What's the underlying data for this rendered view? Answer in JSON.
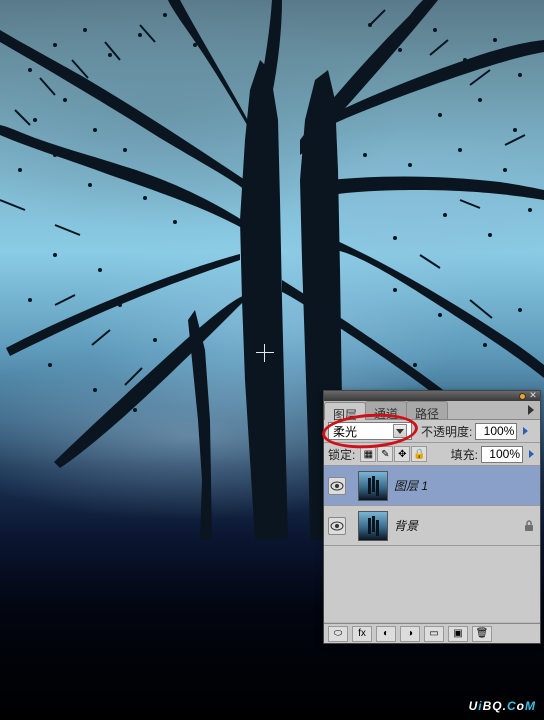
{
  "watermark": {
    "text_prefix": "U",
    "text_mid": "i",
    "text_mid2": "BQ.",
    "text_suffix": "C",
    "text_mid3": "o",
    "text_end": "M"
  },
  "panel": {
    "tabs": {
      "layers": "图层",
      "channels": "通道",
      "paths": "路径"
    },
    "blend_mode": "柔光",
    "opacity_label": "不透明度:",
    "opacity_value": "100%",
    "lock_label": "锁定:",
    "fill_label": "填充:",
    "fill_value": "100%",
    "layers": [
      {
        "name": "图层 1",
        "locked": false
      },
      {
        "name": "背景",
        "locked": true
      }
    ],
    "lock_icons": {
      "transparent": "▦",
      "brush": "✎",
      "move": "✥",
      "all": "🔒"
    }
  }
}
